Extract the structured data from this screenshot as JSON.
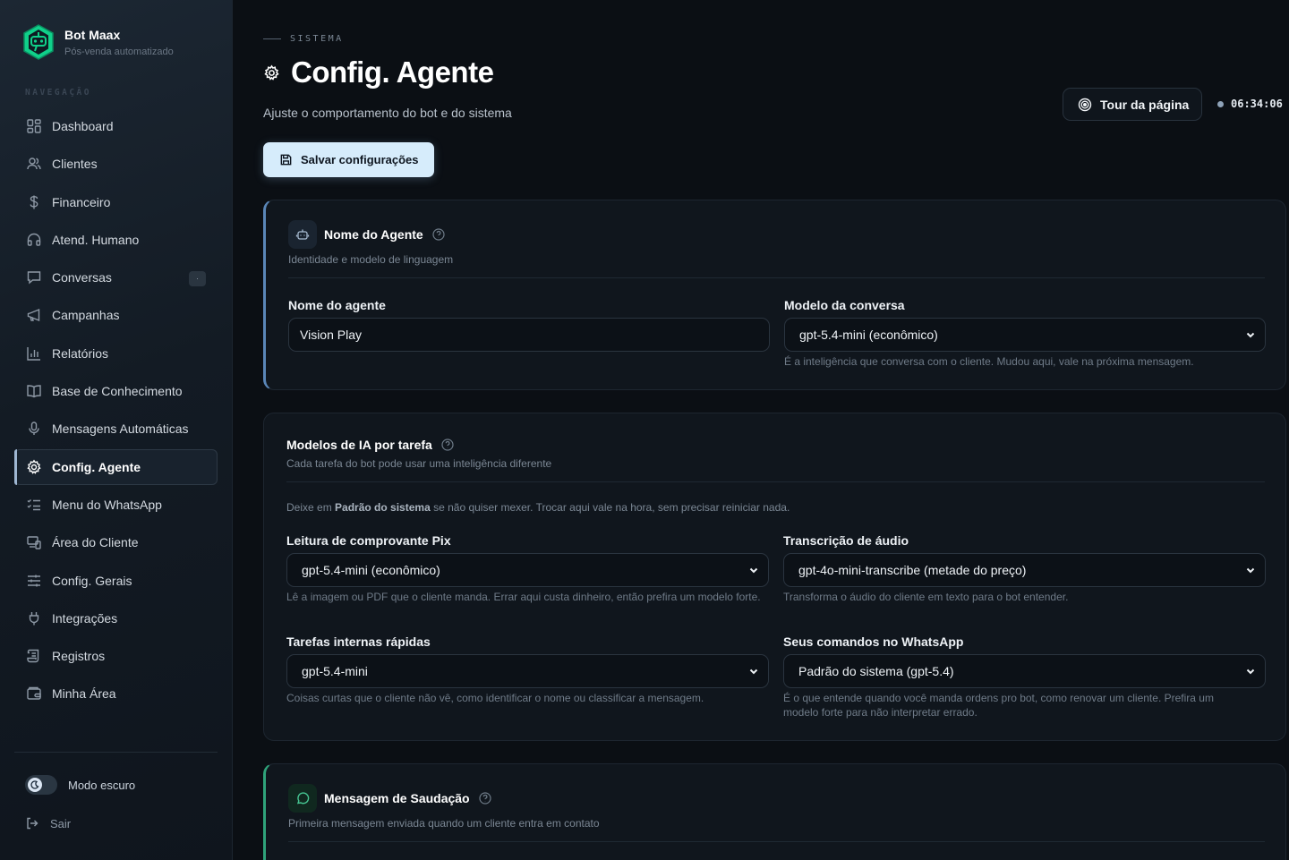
{
  "brand": {
    "name": "Bot Maax",
    "subtitle": "Pós-venda automatizado"
  },
  "sidebar": {
    "heading": "NAVEGAÇÃO",
    "items": [
      {
        "label": "Dashboard",
        "icon": "dashboard-icon"
      },
      {
        "label": "Clientes",
        "icon": "users-icon"
      },
      {
        "label": "Financeiro",
        "icon": "dollar-icon"
      },
      {
        "label": "Atend. Humano",
        "icon": "headset-icon"
      },
      {
        "label": "Conversas",
        "icon": "chat-icon",
        "badge": "·"
      },
      {
        "label": "Campanhas",
        "icon": "megaphone-icon"
      },
      {
        "label": "Relatórios",
        "icon": "bar-chart-icon"
      },
      {
        "label": "Base de Conhecimento",
        "icon": "book-icon"
      },
      {
        "label": "Mensagens Automáticas",
        "icon": "microphone-icon"
      },
      {
        "label": "Config. Agente",
        "icon": "gear-icon",
        "active": true
      },
      {
        "label": "Menu do WhatsApp",
        "icon": "list-check-icon"
      },
      {
        "label": "Área do Cliente",
        "icon": "devices-icon"
      },
      {
        "label": "Config. Gerais",
        "icon": "sliders-icon"
      },
      {
        "label": "Integrações",
        "icon": "plug-icon"
      },
      {
        "label": "Registros",
        "icon": "scroll-icon"
      },
      {
        "label": "Minha Área",
        "icon": "wallet-icon"
      }
    ],
    "dark_mode_label": "Modo escuro",
    "logout_label": "Sair"
  },
  "header": {
    "eyebrow": "SISTEMA",
    "title": "Config. Agente",
    "subtitle": "Ajuste o comportamento do bot e do sistema",
    "save_label": "Salvar configurações",
    "tour_label": "Tour da página",
    "clock": "06:34:06"
  },
  "agent_card": {
    "title": "Nome do Agente",
    "desc": "Identidade e modelo de linguagem",
    "name_label": "Nome do agente",
    "name_value": "Vision Play",
    "model_label": "Modelo da conversa",
    "model_value": "gpt-5.4-mini (econômico)",
    "model_hint": "É a inteligência que conversa com o cliente. Mudou aqui, vale na próxima mensagem."
  },
  "models_card": {
    "title": "Modelos de IA por tarefa",
    "desc": "Cada tarefa do bot pode usar uma inteligência diferente",
    "info_pre": "Deixe em ",
    "info_bold": "Padrão do sistema",
    "info_post": " se não quiser mexer. Trocar aqui vale na hora, sem precisar reiniciar nada.",
    "pix_label": "Leitura de comprovante Pix",
    "pix_value": "gpt-5.4-mini (econômico)",
    "pix_hint": "Lê a imagem ou PDF que o cliente manda. Errar aqui custa dinheiro, então prefira um modelo forte.",
    "audio_label": "Transcrição de áudio",
    "audio_value": "gpt-4o-mini-transcribe (metade do preço)",
    "audio_hint": "Transforma o áudio do cliente em texto para o bot entender.",
    "internal_label": "Tarefas internas rápidas",
    "internal_value": "gpt-5.4-mini",
    "internal_hint": "Coisas curtas que o cliente não vê, como identificar o nome ou classificar a mensagem.",
    "commands_label": "Seus comandos no WhatsApp",
    "commands_value": "Padrão do sistema (gpt-5.4)",
    "commands_hint": "É o que entende quando você manda ordens pro bot, como renovar um cliente. Prefira um modelo forte para não interpretar errado."
  },
  "greeting_card": {
    "title": "Mensagem de Saudação",
    "desc": "Primeira mensagem enviada quando um cliente entra em contato"
  },
  "colors": {
    "accent_blue": "#5a86b8",
    "accent_green": "#2fa37a",
    "primary_button": "#d6ecfb"
  }
}
